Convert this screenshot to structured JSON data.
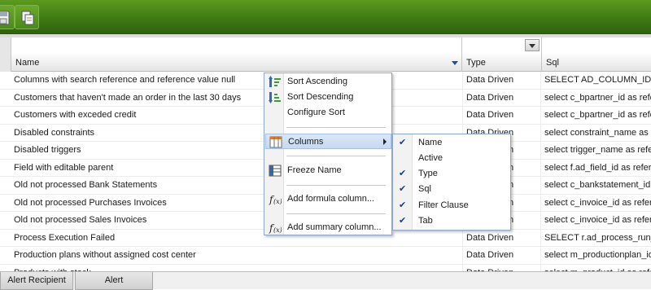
{
  "toolbar": {
    "buttons": [
      {
        "icon": "save-icon"
      },
      {
        "icon": "copy-icon"
      }
    ]
  },
  "grid": {
    "columns": [
      {
        "label": "Name",
        "sorted": "descending-dropdown"
      },
      {
        "label": "Type"
      },
      {
        "label": "Sql"
      }
    ],
    "rows": [
      {
        "name": "Columns with search reference and reference value null",
        "type": "Data Driven",
        "sql": "SELECT AD_COLUMN_ID A"
      },
      {
        "name": "Customers that haven't made an order in the last 30 days",
        "type": "Data Driven",
        "sql": "select c_bpartner_id as refe"
      },
      {
        "name": "Customers with exceded credit",
        "type": "Data Driven",
        "sql": "select c_bpartner_id as refe"
      },
      {
        "name": "Disabled constraints",
        "type": "Data Driven",
        "sql": "select constraint_name as r"
      },
      {
        "name": "Disabled triggers",
        "type": "Data Driven",
        "sql": "select trigger_name as refer"
      },
      {
        "name": "Field with editable parent",
        "type": "Data Driven",
        "sql": "select f.ad_field_id as refere"
      },
      {
        "name": "Old not processed Bank Statements",
        "type": "Data Driven",
        "sql": "select c_bankstatement_id a"
      },
      {
        "name": "Old not processed Purchases Invoices",
        "type": "Data Driven",
        "sql": "select c_invoice_id as refere"
      },
      {
        "name": "Old not processed Sales Invoices",
        "type": "Data Driven",
        "sql": "select c_invoice_id as refere"
      },
      {
        "name": "Process Execution Failed",
        "type": "Data Driven",
        "sql": "SELECT r.ad_process_run_"
      },
      {
        "name": "Production plans without assigned cost center",
        "type": "Data Driven",
        "sql": "select m_productionplan_id a"
      },
      {
        "name": "Products with stock...",
        "type": "Data Driven",
        "sql": "select m_product_id as refer"
      }
    ]
  },
  "context_menu": {
    "items": [
      {
        "label": "Sort Ascending",
        "icon": "sort-ascending-icon"
      },
      {
        "label": "Sort Descending",
        "icon": "sort-descending-icon"
      },
      {
        "label": "Configure Sort",
        "icon": ""
      },
      {
        "label": "Columns",
        "icon": "columns-icon",
        "active": true
      },
      {
        "label": "Freeze Name",
        "icon": "freeze-icon"
      },
      {
        "label": "Add formula column...",
        "icon": "formula-icon"
      },
      {
        "label": "Add summary column...",
        "icon": "formula-icon"
      }
    ]
  },
  "columns_submenu": {
    "items": [
      {
        "label": "Name",
        "checked": true
      },
      {
        "label": "Active",
        "checked": false
      },
      {
        "label": "Type",
        "checked": true
      },
      {
        "label": "Sql",
        "checked": true
      },
      {
        "label": "Filter Clause",
        "checked": true
      },
      {
        "label": "Tab",
        "checked": true
      }
    ]
  },
  "tabs": [
    {
      "label": "Alert Recipient"
    },
    {
      "label": "Alert"
    }
  ],
  "colors": {
    "toolbar_green": "#4a8a18",
    "menu_highlight": "#c5d9f1",
    "check_color": "#1b3f7a"
  }
}
